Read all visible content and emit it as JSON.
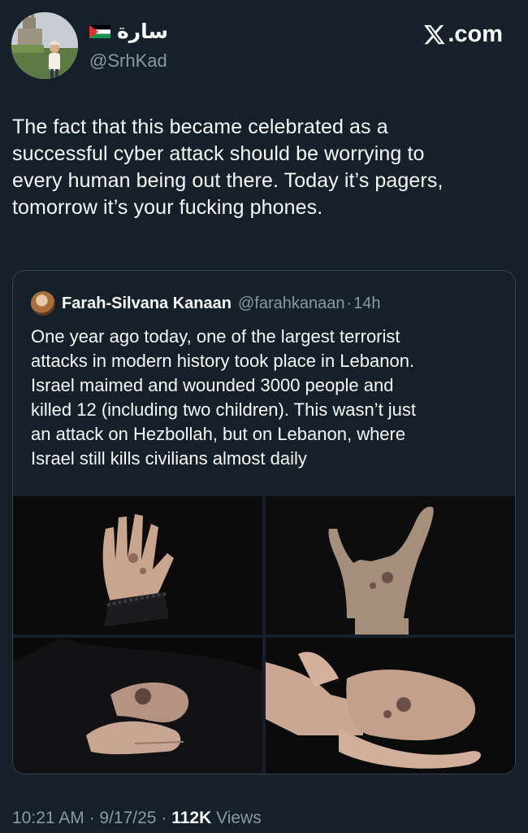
{
  "author": {
    "display_name": "سارة",
    "handle": "@SrhKad",
    "flag": "palestine-flag-icon"
  },
  "brand": {
    "text": ".com"
  },
  "tweet": {
    "text": "The fact that this became celebrated as a\nsuccessful cyber attack should be worrying to\nevery human being out there. Today it’s pagers,\ntomorrow it’s your fucking phones."
  },
  "quoted_tweet": {
    "author_name": "Farah-Silvana Kanaan",
    "author_handle": "@farahkanaan",
    "separator": "·",
    "age": "14h",
    "text": "One year ago today, one of the largest terrorist\nattacks in modern history took place in Lebanon.\nIsrael maimed and wounded 3000 people and\nkilled 12 (including two children). This wasn’t just\nan attack on Hezbollah, but on Lebanon, where\nIsrael still kills civilians almost daily"
  },
  "footer": {
    "time": "10:21 AM",
    "sep1": "·",
    "date": "9/17/25",
    "sep2": "·",
    "views_count": "112K",
    "views_label": "Views"
  },
  "colors": {
    "background": "#15202b",
    "text_primary": "#f7f9f9",
    "text_secondary": "#8b98a5",
    "border": "#38444d"
  }
}
